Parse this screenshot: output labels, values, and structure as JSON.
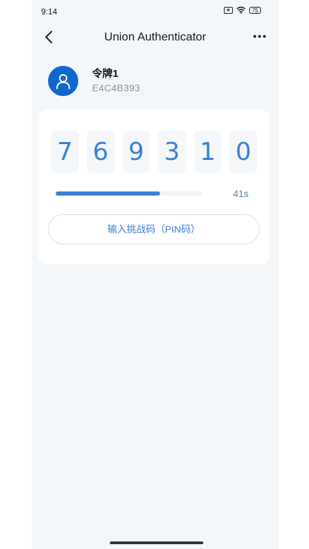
{
  "status_bar": {
    "time": "9:14",
    "battery": "75"
  },
  "app_bar": {
    "title": "Union Authenticator"
  },
  "account": {
    "name": "令牌1",
    "serial": "E4C4B393",
    "avatar_icon": "user-icon",
    "avatar_color": "#1168cc"
  },
  "otp": {
    "digits": [
      "7",
      "6",
      "9",
      "3",
      "1",
      "0"
    ],
    "progress_fraction": 0.71,
    "remaining": "41s",
    "accent_color": "#3a7fd6"
  },
  "pin_button": {
    "label": "输入挑战码（PIN码）"
  }
}
